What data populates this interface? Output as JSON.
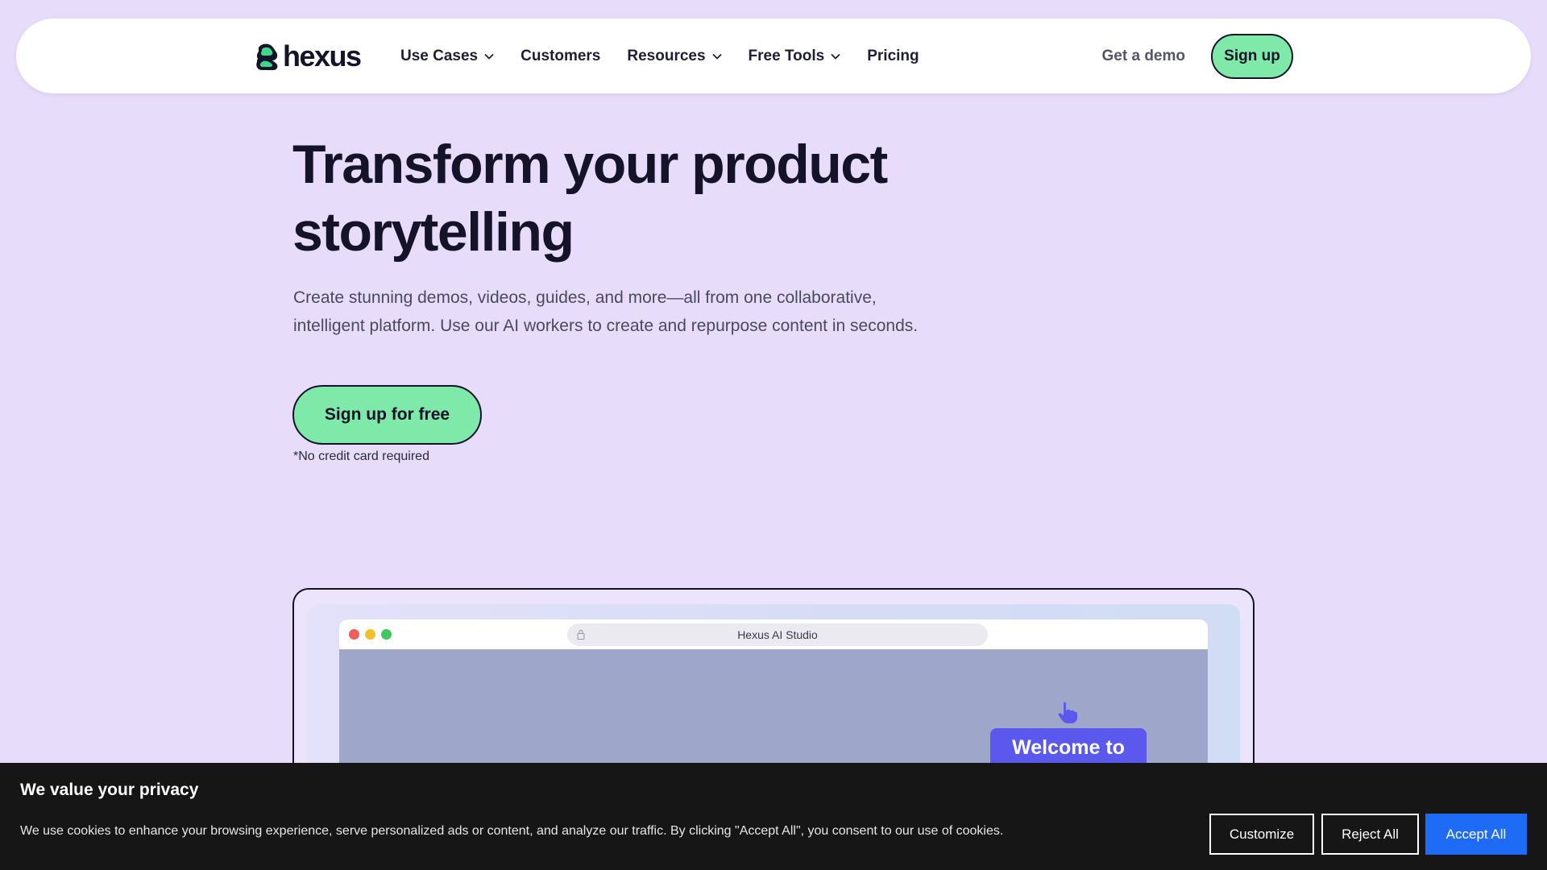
{
  "nav": {
    "logo_text": "hexus",
    "items": [
      {
        "label": "Use Cases",
        "has_dropdown": true
      },
      {
        "label": "Customers",
        "has_dropdown": false
      },
      {
        "label": "Resources",
        "has_dropdown": true
      },
      {
        "label": "Free Tools",
        "has_dropdown": true
      },
      {
        "label": "Pricing",
        "has_dropdown": false
      }
    ],
    "demo_label": "Get a demo",
    "signup_label": "Sign up"
  },
  "hero": {
    "title_line1": "Transform your product",
    "title_line2": "storytelling",
    "subtitle_line1": "Create stunning demos, videos, guides, and more—all from one collaborative,",
    "subtitle_line2": "intelligent platform. Use our AI workers to create and repurpose content in seconds.",
    "cta_label": "Sign up for free",
    "note": "*No credit card required"
  },
  "mockup": {
    "url_text": "Hexus AI Studio",
    "welcome_text": "Welcome to"
  },
  "cookie": {
    "title": "We value your privacy",
    "text": "We use cookies to enhance your browsing experience, serve personalized ads or content, and analyze our traffic. By clicking \"Accept All\", you consent to our use of cookies.",
    "customize_label": "Customize",
    "reject_label": "Reject All",
    "accept_label": "Accept All"
  },
  "colors": {
    "background": "#e8dcfb",
    "accent_green": "#7ee9a8",
    "accept_blue": "#1e6bf5",
    "welcome_purple": "#5b58ee"
  },
  "icons": [
    "hexus-logo-icon",
    "chevron-down-icon",
    "lock-icon",
    "hand-pointer-icon"
  ]
}
